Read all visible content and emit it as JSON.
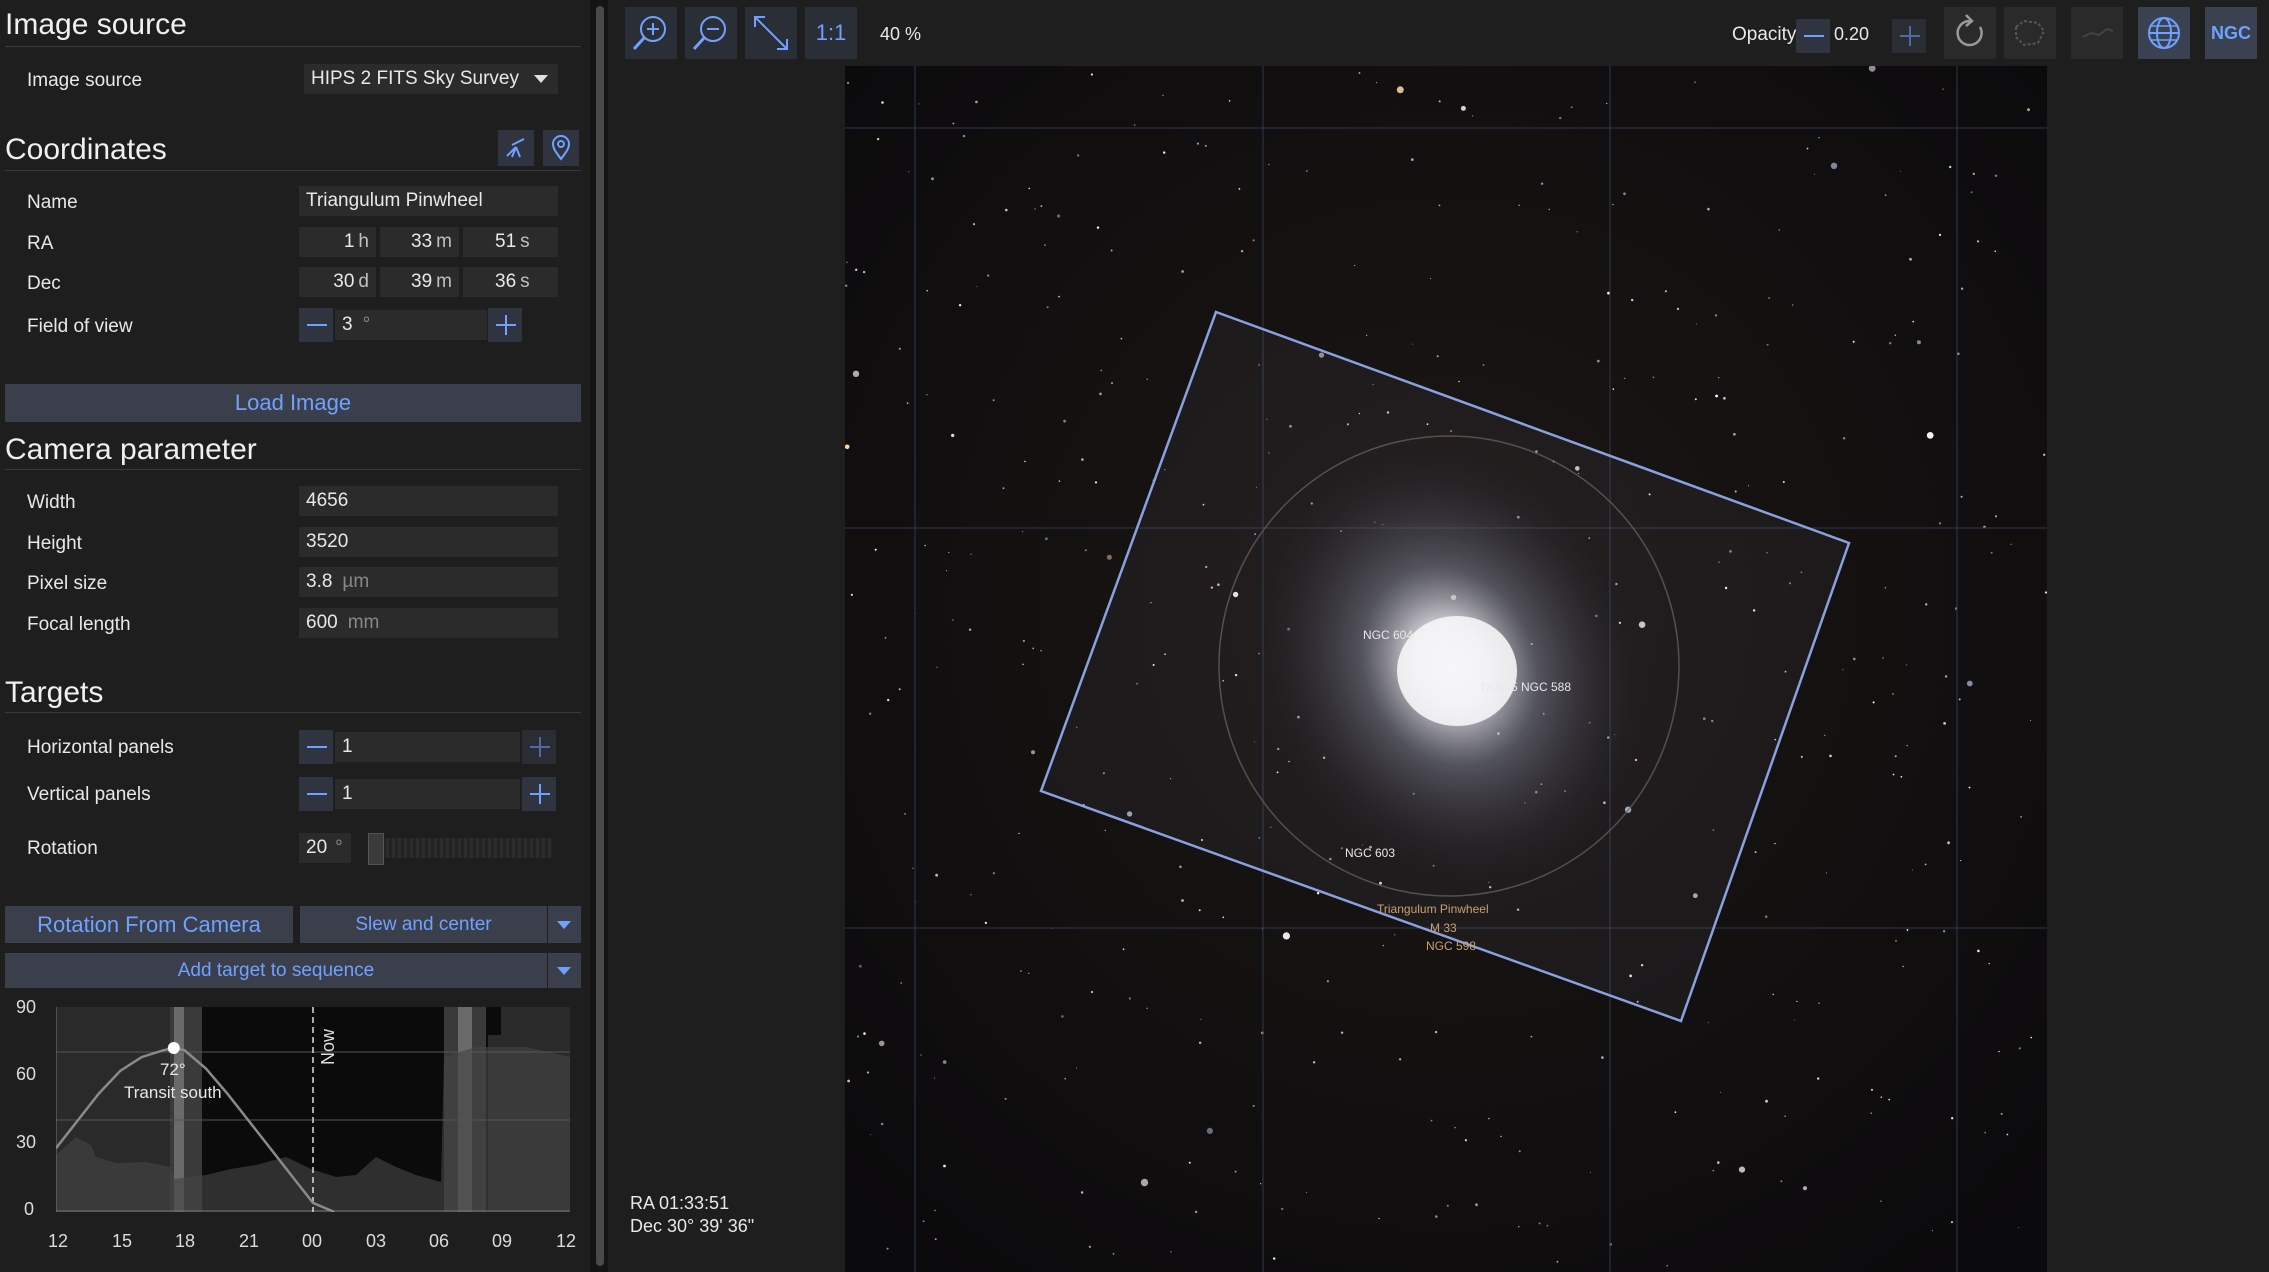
{
  "image_source": {
    "section_title": "Image source",
    "label": "Image source",
    "selected": "HIPS 2 FITS Sky Survey"
  },
  "coordinates": {
    "section_title": "Coordinates",
    "name_label": "Name",
    "name_value": "Triangulum Pinwheel",
    "ra_label": "RA",
    "ra": {
      "h": "1",
      "h_unit": "h",
      "m": "33",
      "m_unit": "m",
      "s": "51",
      "s_unit": "s"
    },
    "dec_label": "Dec",
    "dec": {
      "d": "30",
      "d_unit": "d",
      "m": "39",
      "m_unit": "m",
      "s": "36",
      "s_unit": "s"
    },
    "fov_label": "Field of view",
    "fov_value": "3",
    "fov_unit": "°",
    "load_button": "Load Image"
  },
  "camera": {
    "section_title": "Camera parameter",
    "width_label": "Width",
    "width_value": "4656",
    "height_label": "Height",
    "height_value": "3520",
    "pixel_label": "Pixel size",
    "pixel_value": "3.8",
    "pixel_unit": "µm",
    "focal_label": "Focal length",
    "focal_value": "600",
    "focal_unit": "mm"
  },
  "targets": {
    "section_title": "Targets",
    "hpanels_label": "Horizontal panels",
    "hpanels_value": "1",
    "vpanels_label": "Vertical panels",
    "vpanels_value": "1",
    "rotation_label": "Rotation",
    "rotation_value": "20",
    "rotation_unit": "°",
    "rotation_fraction": 0.0,
    "rotation_from_camera": "Rotation From Camera",
    "slew_center": "Slew and center",
    "add_target": "Add target to sequence"
  },
  "altitude_chart": {
    "y_ticks": [
      "90",
      "60",
      "30",
      "0"
    ],
    "x_ticks": [
      "12",
      "15",
      "18",
      "21",
      "00",
      "03",
      "06",
      "09",
      "12"
    ],
    "now_label": "Now",
    "peak_value": "72°",
    "peak_label": "Transit south"
  },
  "chart_data": {
    "type": "line",
    "x_ticks": [
      "12",
      "15",
      "18",
      "21",
      "00",
      "03",
      "06",
      "09",
      "12"
    ],
    "ylim": [
      0,
      90
    ],
    "series": [
      {
        "values_x_hours": [
          12,
          13,
          14,
          15,
          16,
          17,
          17.5,
          18,
          19,
          20,
          21,
          22,
          23,
          24,
          25
        ],
        "values": [
          28,
          40,
          52,
          62,
          68,
          71,
          72,
          71,
          63,
          52,
          40,
          28,
          16,
          4,
          0
        ]
      }
    ],
    "annotations": [
      {
        "x": "17.5",
        "text": "72°"
      },
      {
        "x": "17.5",
        "text": "Transit south"
      },
      {
        "x": "00",
        "text": "Now"
      }
    ]
  },
  "toolbar": {
    "zoom_level": "40 %",
    "one_to_one": "1:1",
    "opacity_label": "Opacity",
    "opacity_value": "0.20",
    "ngc_label": "NGC"
  },
  "sky": {
    "target_label_1": "Triangulum Pinwheel",
    "target_label_2": "M 33",
    "target_label_3": "NGC 598",
    "ngc_604": "NGC 604",
    "ngc_588": "NGC 5  NGC 588",
    "ngc_603": "NGC 603"
  },
  "status": {
    "ra": "RA  01:33:51",
    "dec": "Dec  30° 39' 36\""
  },
  "colors": {
    "accent": "#6fa1ff",
    "panel_bg": "#1e1e1f",
    "field_bg": "#2b2b2c",
    "button_bg": "#3a3f4b"
  }
}
